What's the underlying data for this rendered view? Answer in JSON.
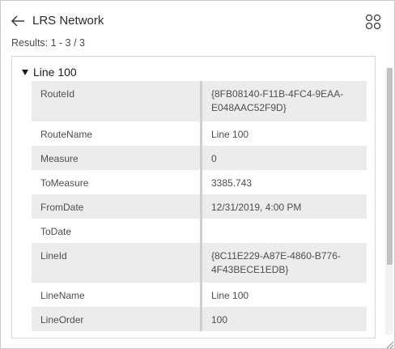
{
  "header": {
    "title": "LRS Network"
  },
  "results": {
    "text": "Results: 1 - 3 / 3"
  },
  "feature": {
    "title": "Line 100"
  },
  "attributes": [
    {
      "name": "RouteId",
      "value": "{8FB08140-F11B-4FC4-9EAA-E048AAC52F9D}"
    },
    {
      "name": "RouteName",
      "value": "Line 100"
    },
    {
      "name": "Measure",
      "value": "0"
    },
    {
      "name": "ToMeasure",
      "value": "3385.743"
    },
    {
      "name": "FromDate",
      "value": "12/31/2019, 4:00 PM"
    },
    {
      "name": "ToDate",
      "value": ""
    },
    {
      "name": "LineId",
      "value": "{8C11E229-A87E-4860-B776-4F43BECE1EDB}"
    },
    {
      "name": "LineName",
      "value": "Line 100"
    },
    {
      "name": "LineOrder",
      "value": "100"
    }
  ],
  "icons": {
    "back": "arrow-left-icon",
    "grid": "grid-view-icon",
    "caret": "caret-down-icon",
    "resize": "resize-grip-icon"
  },
  "colors": {
    "row_shade": "#ececec",
    "divider": "#cfcfcf",
    "scroll_thumb": "#c2c2c2"
  }
}
